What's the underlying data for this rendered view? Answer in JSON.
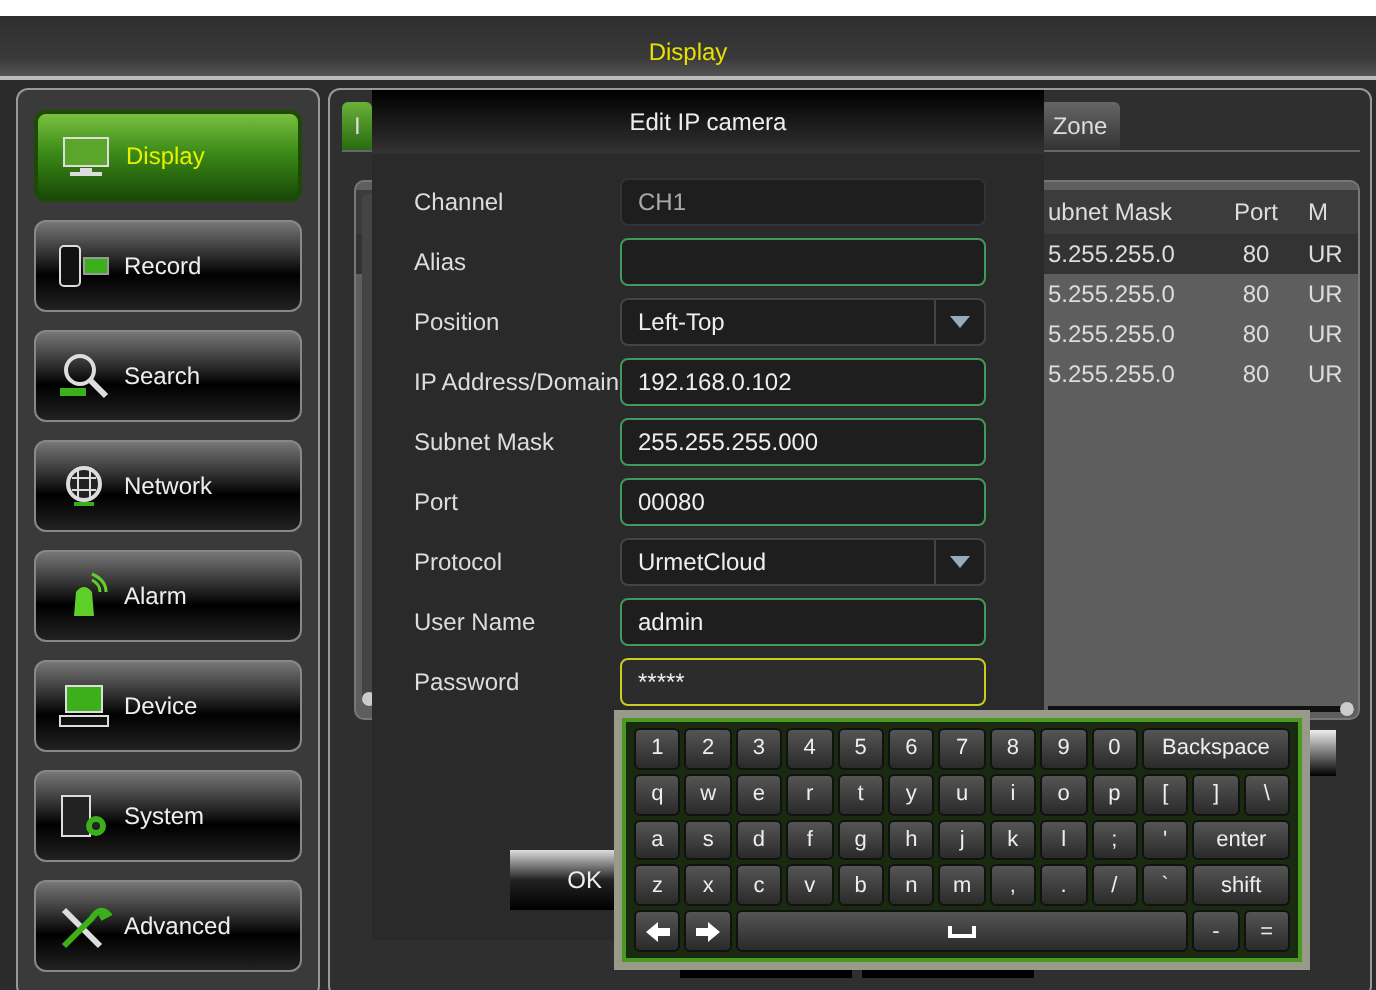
{
  "title_bar": {
    "title": "Display"
  },
  "sidebar": {
    "items": [
      {
        "label": "Display",
        "selected": true
      },
      {
        "label": "Record",
        "selected": false
      },
      {
        "label": "Search",
        "selected": false
      },
      {
        "label": "Network",
        "selected": false
      },
      {
        "label": "Alarm",
        "selected": false
      },
      {
        "label": "Device",
        "selected": false
      },
      {
        "label": "System",
        "selected": false
      },
      {
        "label": "Advanced",
        "selected": false
      }
    ]
  },
  "tabs": [
    {
      "label": "I",
      "selected": true
    },
    {
      "label": "Zone",
      "selected": false
    }
  ],
  "table": {
    "columns": [
      "ubnet Mask",
      "Port",
      "M"
    ],
    "rows": [
      {
        "cells": [
          "5.255.255.0",
          "80",
          "UR"
        ],
        "selected": true
      },
      {
        "cells": [
          "5.255.255.0",
          "80",
          "UR"
        ],
        "selected": false
      },
      {
        "cells": [
          "5.255.255.0",
          "80",
          "UR"
        ],
        "selected": false
      },
      {
        "cells": [
          "5.255.255.0",
          "80",
          "UR"
        ],
        "selected": false
      }
    ]
  },
  "dialog": {
    "title": "Edit IP camera",
    "fields": [
      {
        "label": "Channel",
        "value": "CH1",
        "kind": "readonly",
        "focused": false
      },
      {
        "label": "Alias",
        "kind": "text",
        "focused": false
      },
      {
        "label": "Position",
        "value": "Left-Top",
        "kind": "select",
        "focused": false
      },
      {
        "label": "IP Address/Domain",
        "value": "192.168.0.102",
        "kind": "text",
        "focused": false
      },
      {
        "label": "Subnet Mask",
        "value": "255.255.255.000",
        "kind": "text",
        "focused": false
      },
      {
        "label": "Port",
        "value": "00080",
        "kind": "text",
        "focused": false
      },
      {
        "label": "Protocol",
        "value": "UrmetCloud",
        "kind": "select",
        "focused": false
      },
      {
        "label": "User Name",
        "value": "admin",
        "kind": "text",
        "focused": false
      },
      {
        "label": "Password",
        "value": "*****",
        "kind": "text",
        "focused": true
      }
    ],
    "ok_button": "OK"
  },
  "keyboard": {
    "rows": [
      {
        "keys": [
          {
            "label": "1",
            "kind": "key"
          },
          {
            "label": "2",
            "kind": "key"
          },
          {
            "label": "3",
            "kind": "key"
          },
          {
            "label": "4",
            "kind": "key"
          },
          {
            "label": "5",
            "kind": "key"
          },
          {
            "label": "6",
            "kind": "key"
          },
          {
            "label": "7",
            "kind": "key"
          },
          {
            "label": "8",
            "kind": "key"
          },
          {
            "label": "9",
            "kind": "key"
          },
          {
            "label": "0",
            "kind": "key"
          },
          {
            "label": "Backspace",
            "kind": "wide"
          }
        ]
      },
      {
        "keys": [
          {
            "label": "q",
            "kind": "key"
          },
          {
            "label": "w",
            "kind": "key"
          },
          {
            "label": "e",
            "kind": "key"
          },
          {
            "label": "r",
            "kind": "key"
          },
          {
            "label": "t",
            "kind": "key"
          },
          {
            "label": "y",
            "kind": "key"
          },
          {
            "label": "u",
            "kind": "key"
          },
          {
            "label": "i",
            "kind": "key"
          },
          {
            "label": "o",
            "kind": "key"
          },
          {
            "label": "p",
            "kind": "key"
          },
          {
            "label": "[",
            "kind": "key"
          },
          {
            "label": "]",
            "kind": "key"
          },
          {
            "label": "\\",
            "kind": "key"
          }
        ]
      },
      {
        "keys": [
          {
            "label": "a",
            "kind": "key"
          },
          {
            "label": "s",
            "kind": "key"
          },
          {
            "label": "d",
            "kind": "key"
          },
          {
            "label": "f",
            "kind": "key"
          },
          {
            "label": "g",
            "kind": "key"
          },
          {
            "label": "h",
            "kind": "key"
          },
          {
            "label": "j",
            "kind": "key"
          },
          {
            "label": "k",
            "kind": "key"
          },
          {
            "label": "l",
            "kind": "key"
          },
          {
            "label": ";",
            "kind": "key"
          },
          {
            "label": "'",
            "kind": "key"
          },
          {
            "label": "enter",
            "kind": "wide"
          }
        ]
      },
      {
        "keys": [
          {
            "label": "z",
            "kind": "key"
          },
          {
            "label": "x",
            "kind": "key"
          },
          {
            "label": "c",
            "kind": "key"
          },
          {
            "label": "v",
            "kind": "key"
          },
          {
            "label": "b",
            "kind": "key"
          },
          {
            "label": "n",
            "kind": "key"
          },
          {
            "label": "m",
            "kind": "key"
          },
          {
            "label": ",",
            "kind": "key"
          },
          {
            "label": ".",
            "kind": "key"
          },
          {
            "label": "/",
            "kind": "key"
          },
          {
            "label": "`",
            "kind": "key"
          },
          {
            "label": "shift",
            "kind": "wide"
          }
        ]
      },
      {
        "keys": [
          {
            "kind": "left"
          },
          {
            "kind": "right"
          },
          {
            "kind": "space"
          },
          {
            "label": "-",
            "kind": "key"
          },
          {
            "label": "=",
            "kind": "key"
          }
        ]
      }
    ]
  }
}
